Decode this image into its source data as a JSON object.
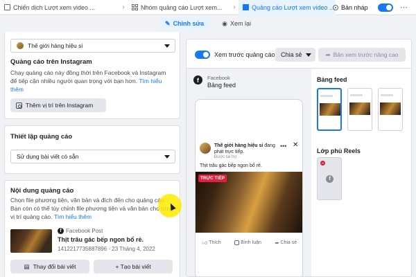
{
  "breadcrumb": {
    "campaign": "Chiến dịch Lượt xem video ...",
    "adset": "Nhóm quảng cáo Lượt xem...",
    "ad": "Quảng cáo Lượt xem video ..."
  },
  "draft_label": "Bản nháp",
  "modes": {
    "edit": "Chỉnh sửa",
    "review": "Xem lại"
  },
  "identity": {
    "page_select": "Thế giới hàng hiệu si"
  },
  "instagram": {
    "title": "Quảng cáo trên Instagram",
    "desc": "Chạy quảng cáo này đồng thời trên Facebook và Instagram để tiếp cận nhiều người quan trọng với bạn hơn.",
    "learn_more": "Tìm hiểu thêm",
    "button": "Thêm vị trí trên Instagram"
  },
  "ad_setup": {
    "title": "Thiết lập quảng cáo",
    "select": "Sử dụng bài viết có sẵn"
  },
  "ad_content": {
    "title": "Nội dung quảng cáo",
    "desc": "Chọn file phương tiện, văn bản và đích đến cho quảng cáo. Bạn còn có thể tùy chỉnh file phương tiện và văn bản cho từng vị trí quảng cáo.",
    "learn_more": "Tìm hiểu thêm",
    "post_label": "Facebook Post",
    "post_title": "Thịt trâu gác bếp ngon bổ rẻ.",
    "post_meta": "1412217735887896 - 23 Tháng 4, 2022",
    "change_button": "Thay đổi bài viết",
    "add_button": "+ Tạo bài viết"
  },
  "preview": {
    "toggle_label": "Xem trước quảng cáo",
    "share": "Chia sẻ",
    "advanced": "Bản xem trước nâng cao",
    "platform_small": "Facebook",
    "placement": "Bảng feed",
    "page_name": "Thế giới hàng hiệu si",
    "page_status": " đang phát trực tiếp.",
    "sponsored": "Được tài trợ ·",
    "caption": "Thịt trâu gác bếp ngon bổ rẻ.",
    "live_badge": "TRỰC TIẾP",
    "like": "Thích",
    "comment": "Bình luận",
    "share_action": "Chia sẻ"
  },
  "side": {
    "feed_title": "Bảng feed",
    "reels_title": "Lớp phủ Reels"
  },
  "icons": {
    "campaign": "folder-icon",
    "adset": "grid-icon",
    "ad": "ad-icon",
    "edit": "pencil-icon",
    "review": "eye-icon",
    "facebook": "facebook-icon"
  },
  "colors": {
    "accent": "#1877f2",
    "live": "#e41e3f",
    "highlight": "#ffeb00"
  }
}
